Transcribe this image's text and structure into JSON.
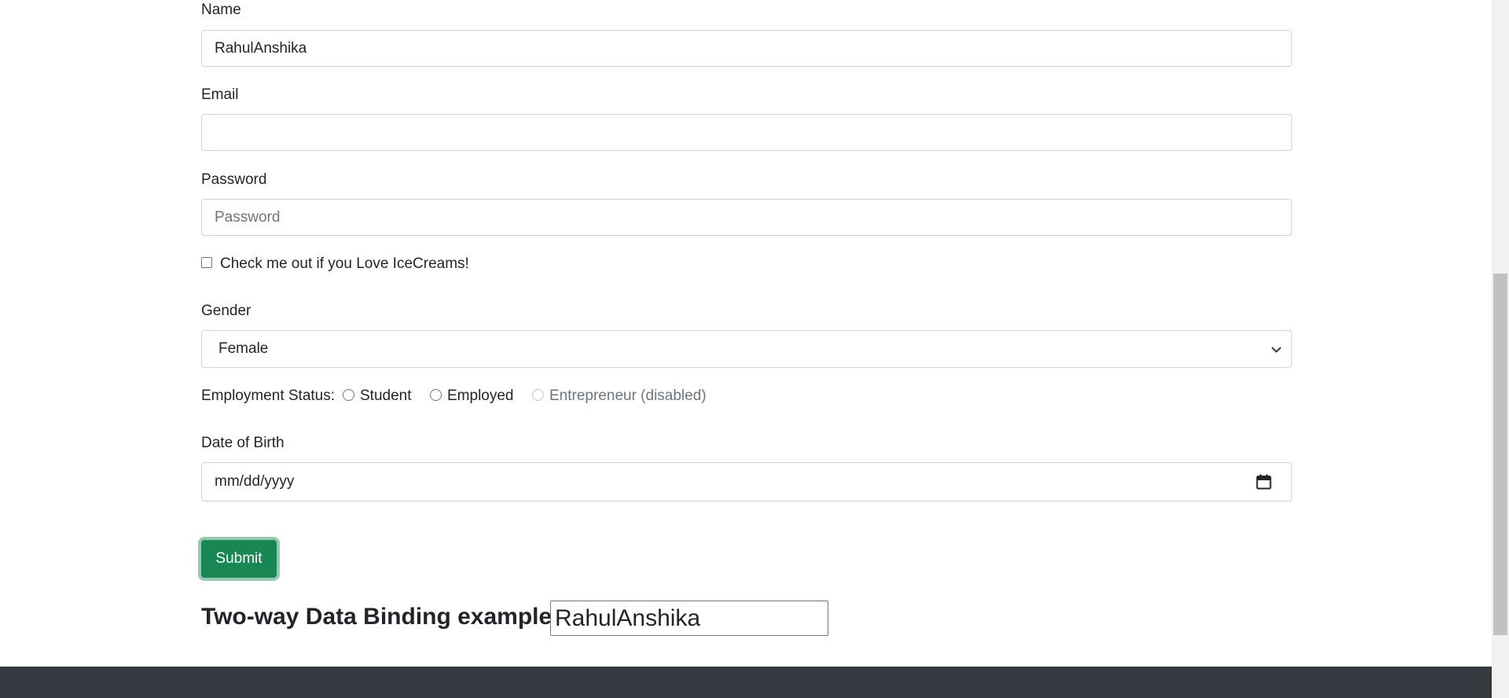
{
  "form": {
    "name": {
      "label": "Name",
      "value": "RahulAnshika"
    },
    "email": {
      "label": "Email",
      "value": ""
    },
    "password": {
      "label": "Password",
      "placeholder": "Password"
    },
    "icecream_checkbox": {
      "label": "Check me out if you Love IceCreams!",
      "checked": false
    },
    "gender": {
      "label": "Gender",
      "selected": "Female"
    },
    "employment": {
      "label": "Employment Status:",
      "options": [
        {
          "label": "Student",
          "disabled": false
        },
        {
          "label": "Employed",
          "disabled": false
        },
        {
          "label": "Entrepreneur (disabled)",
          "disabled": true
        }
      ]
    },
    "dob": {
      "label": "Date of Birth",
      "placeholder": "mm/dd/yyyy"
    },
    "submit_label": "Submit"
  },
  "binding": {
    "heading": "Two-way Data Binding example:",
    "value": "RahulAnshika"
  },
  "colors": {
    "submit": "#198754",
    "footer": "#343a40",
    "input_border": "#ced4da",
    "muted": "#6c757d"
  }
}
